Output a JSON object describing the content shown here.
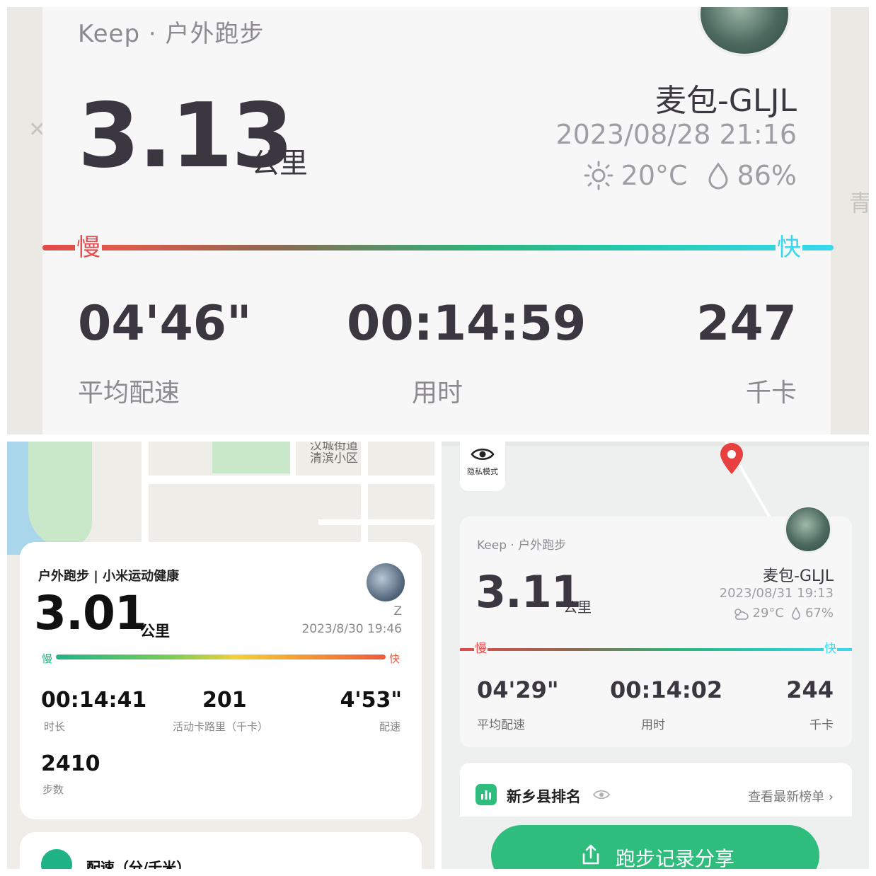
{
  "top": {
    "source": "Keep · 户外跑步",
    "distance": "3.13",
    "unit": "公里",
    "name": "麦包-GLJL",
    "datetime": "2023/08/28 21:16",
    "temperature": "20°C",
    "humidity": "86%",
    "slow_label": "慢",
    "fast_label": "快",
    "stats": [
      {
        "value": "04'46\"",
        "label": "平均配速"
      },
      {
        "value": "00:14:59",
        "label": "用时"
      },
      {
        "value": "247",
        "label": "千卡"
      }
    ],
    "map_chars": [
      "青"
    ]
  },
  "bottom_left": {
    "map_label_1": "汉城街道",
    "map_label_2": "清滨小区",
    "title": "户外跑步 | 小米运动健康",
    "distance": "3.01",
    "unit": "公里",
    "user": "Z",
    "datetime": "2023/8/30 19:46",
    "slow_label": "慢",
    "fast_label": "快",
    "stats": [
      {
        "value": "00:14:41",
        "label": "时长"
      },
      {
        "value": "201",
        "label": "活动卡路里（千卡）"
      },
      {
        "value": "4'53\"",
        "label": "配速"
      }
    ],
    "steps": {
      "value": "2410",
      "label": "步数"
    },
    "pace_section_title": "配速（分/千米）"
  },
  "bottom_right": {
    "privacy_label": "隐私模式",
    "source": "Keep · 户外跑步",
    "distance": "3.11",
    "unit": "公里",
    "name": "麦包-GLJL",
    "datetime": "2023/08/31 19:13",
    "temperature": "29°C",
    "humidity": "67%",
    "slow_label": "慢",
    "fast_label": "快",
    "stats": [
      {
        "value": "04'29\"",
        "label": "平均配速"
      },
      {
        "value": "00:14:02",
        "label": "用时"
      },
      {
        "value": "244",
        "label": "千卡"
      }
    ],
    "ranking_title": "新乡县排名",
    "ranking_link": "查看最新榜单 ›",
    "share_button": "跑步记录分享"
  },
  "colors": {
    "keep_slow": "#e24e4e",
    "keep_fast": "#3ad8ee",
    "mi_slow": "#20b386",
    "mi_fast": "#ef5a3c",
    "keep_green": "#2fbd7e"
  }
}
